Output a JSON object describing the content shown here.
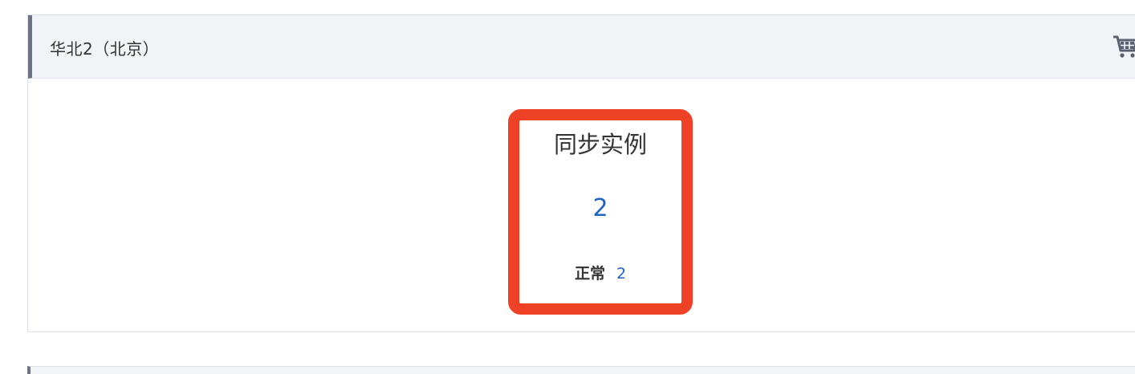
{
  "region": {
    "title": "华北2（北京）",
    "cart_icon": "shopping-cart-icon"
  },
  "card": {
    "title": "同步实例",
    "count": "2",
    "status_label": "正常",
    "status_value": "2"
  },
  "colors": {
    "accent_blue": "#1d63c5",
    "highlight_red": "#ee4125",
    "header_bg": "#f2f3f7"
  }
}
